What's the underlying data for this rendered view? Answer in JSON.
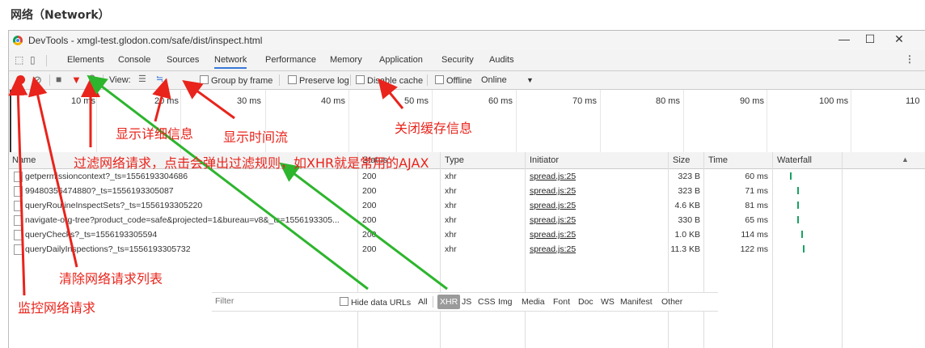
{
  "heading": "网络（Network）",
  "window": {
    "title": "DevTools - xmgl-test.glodon.com/safe/dist/inspect.html",
    "controls": {
      "minimize": "—",
      "maximize": "☐",
      "close": "✕"
    }
  },
  "tabs": [
    "Elements",
    "Console",
    "Sources",
    "Network",
    "Performance",
    "Memory",
    "Application",
    "Security",
    "Audits"
  ],
  "active_tab": "Network",
  "toolbar": {
    "view_label": "View:",
    "group_by_frame": "Group by frame",
    "preserve_log": "Preserve log",
    "disable_cache": "Disable cache",
    "offline": "Offline",
    "throttle": "Online",
    "throttle_arrow": "▼"
  },
  "timeline_ticks": [
    "10 ms",
    "20 ms",
    "30 ms",
    "40 ms",
    "50 ms",
    "60 ms",
    "70 ms",
    "80 ms",
    "90 ms",
    "100 ms",
    "110"
  ],
  "columns": {
    "name": "Name",
    "status": "Status",
    "type": "Type",
    "initiator": "Initiator",
    "size": "Size",
    "time": "Time",
    "waterfall": "Waterfall",
    "sort": "▲"
  },
  "requests": [
    {
      "name": "getpermissioncontext?_ts=1556193304686",
      "status": "200",
      "type": "xhr",
      "initiator": "spread.js:25",
      "size": "323 B",
      "time": "60 ms"
    },
    {
      "name": "99480356474880?_ts=1556193305087",
      "status": "200",
      "type": "xhr",
      "initiator": "spread.js:25",
      "size": "323 B",
      "time": "71 ms"
    },
    {
      "name": "queryRoutineInspectSets?_ts=1556193305220",
      "status": "200",
      "type": "xhr",
      "initiator": "spread.js:25",
      "size": "4.6 KB",
      "time": "81 ms"
    },
    {
      "name": "navigate-org-tree?product_code=safe&projected=1&bureau=v8&_ts=1556193305...",
      "status": "200",
      "type": "xhr",
      "initiator": "spread.js:25",
      "size": "330 B",
      "time": "65 ms"
    },
    {
      "name": "queryChecks?_ts=1556193305594",
      "status": "200",
      "type": "xhr",
      "initiator": "spread.js:25",
      "size": "1.0 KB",
      "time": "114 ms"
    },
    {
      "name": "queryDailyInspections?_ts=1556193305732",
      "status": "200",
      "type": "xhr",
      "initiator": "spread.js:25",
      "size": "11.3 KB",
      "time": "122 ms"
    }
  ],
  "filter": {
    "placeholder": "Filter",
    "hide_data_urls": "Hide data URLs",
    "types": [
      "All",
      "XHR",
      "JS",
      "CSS",
      "Img",
      "Media",
      "Font",
      "Doc",
      "WS",
      "Manifest",
      "Other"
    ],
    "active_type": "XHR"
  },
  "annotations": {
    "details": "显示详细信息",
    "timeflow": "显示时间流",
    "disable_cache": "关闭缓存信息",
    "filter": "过滤网络请求，点击会弹出过滤规则，如XHR就是常用的AJAX",
    "clear": "清除网络请求列表",
    "record": "监控网络请求"
  },
  "colors": {
    "annotation": "#e8241c",
    "arrow_green": "#2db52d",
    "record": "#e8241c",
    "waterfall": "#1aa260",
    "active_tab_underline": "#3879d9"
  }
}
